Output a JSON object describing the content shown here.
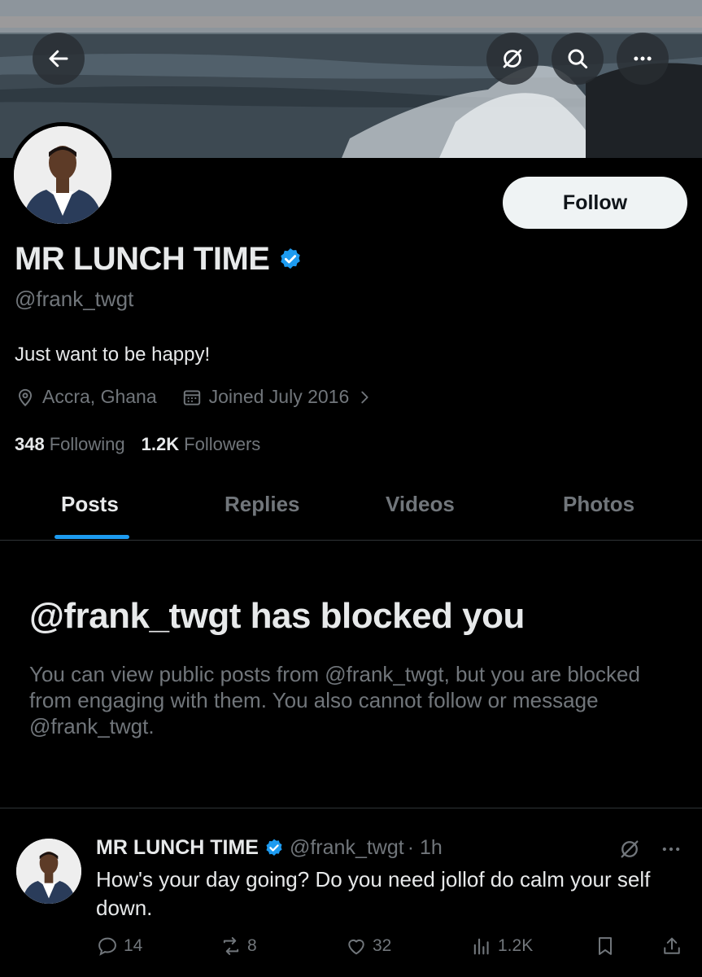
{
  "header": {
    "back_icon": "arrow-left-icon",
    "grok_icon": "grok-icon",
    "search_icon": "search-icon",
    "more_icon": "more-icon"
  },
  "profile": {
    "follow_label": "Follow",
    "name": "MR LUNCH TIME",
    "verified": true,
    "handle": "@frank_twgt",
    "bio": "Just want to be happy!",
    "location": "Accra, Ghana",
    "joined": "Joined July 2016",
    "following_count": "348",
    "following_label": "Following",
    "followers_count": "1.2K",
    "followers_label": "Followers"
  },
  "tabs": [
    {
      "label": "Posts",
      "active": true
    },
    {
      "label": "Replies",
      "active": false
    },
    {
      "label": "Videos",
      "active": false
    },
    {
      "label": "Photos",
      "active": false
    }
  ],
  "blocked": {
    "title": "@frank_twgt has blocked you",
    "text": "You can view public posts from @frank_twgt, but you are blocked from engaging with them. You also cannot follow or message @frank_twgt."
  },
  "post": {
    "name": "MR LUNCH TIME",
    "handle": "@frank_twgt",
    "time": "· 1h",
    "text": "How's your day going?  Do you need jollof do calm your self down.",
    "replies": "14",
    "reposts": "8",
    "likes": "32",
    "views": "1.2K"
  },
  "colors": {
    "accent": "#1d9bf0",
    "verified": "#1d9bf0",
    "muted": "#71767b",
    "text": "#e7e9ea",
    "background": "#000000"
  }
}
